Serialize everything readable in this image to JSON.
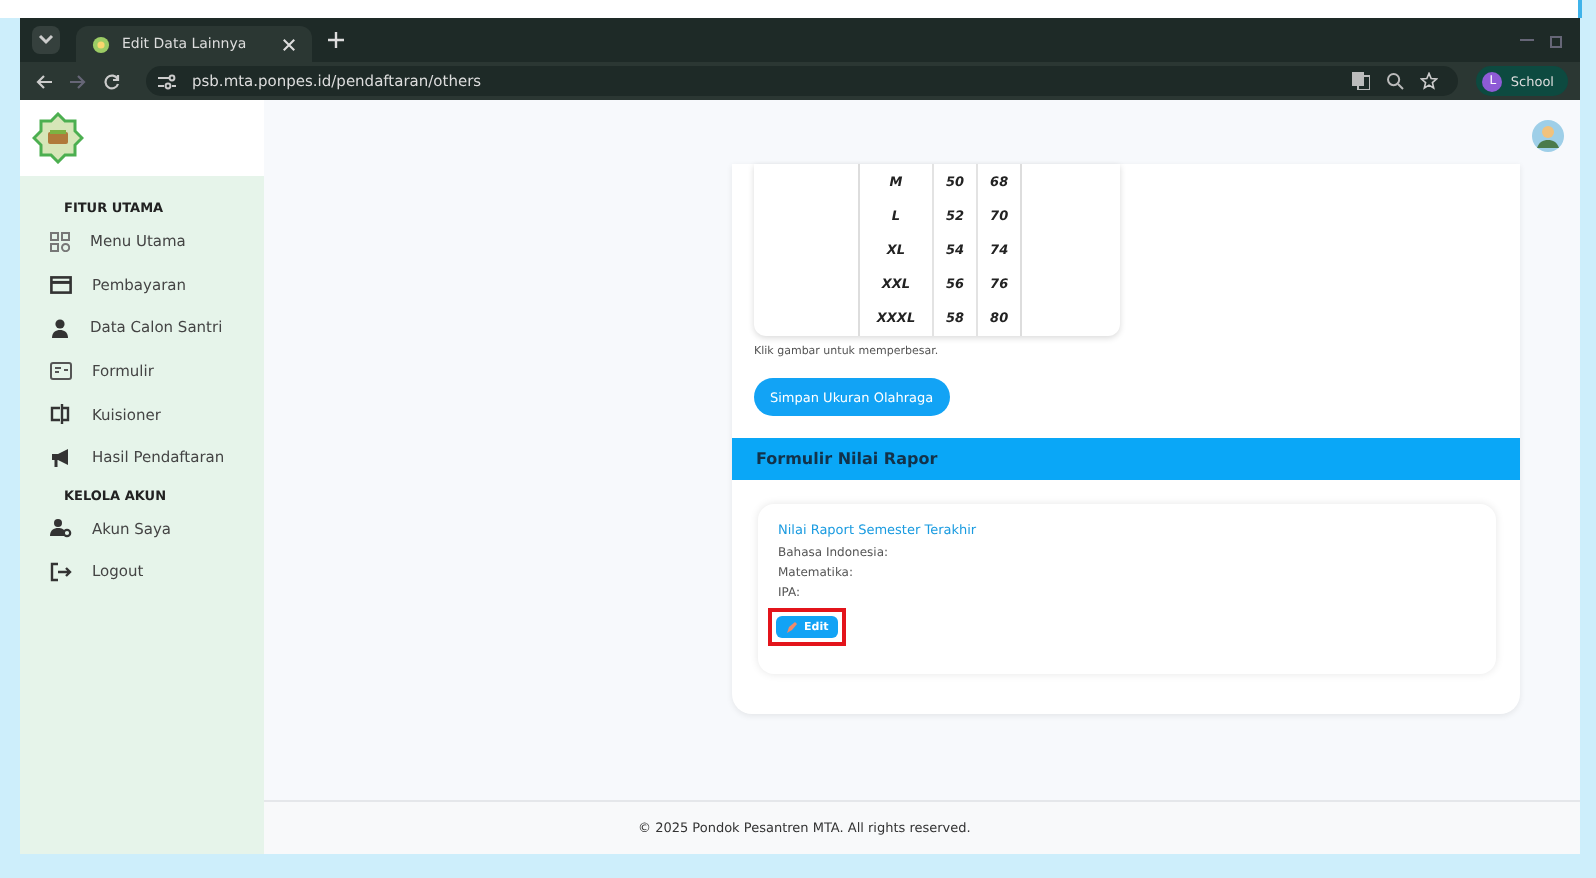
{
  "browser": {
    "tab_title": "Edit Data Lainnya",
    "url": "psb.mta.ponpes.id/pendaftaran/others",
    "profile_initial": "L",
    "profile_name": "School"
  },
  "sidebar": {
    "sections": [
      {
        "heading": "FITUR UTAMA",
        "items": [
          {
            "label": "Menu Utama",
            "kind": "grid"
          },
          {
            "label": "Pembayaran",
            "kind": "card"
          },
          {
            "label": "Data Calon Santri",
            "kind": "person"
          },
          {
            "label": "Formulir",
            "kind": "form"
          },
          {
            "label": "Kuisioner",
            "kind": "quiz"
          },
          {
            "label": "Hasil Pendaftaran",
            "kind": "megaphone"
          }
        ]
      },
      {
        "heading": "KELOLA AKUN",
        "items": [
          {
            "label": "Akun Saya",
            "kind": "account"
          },
          {
            "label": "Logout",
            "kind": "logout"
          }
        ]
      }
    ]
  },
  "size_table": {
    "rows": [
      [
        "M",
        "50",
        "68"
      ],
      [
        "L",
        "52",
        "70"
      ],
      [
        "XL",
        "54",
        "74"
      ],
      [
        "XXL",
        "56",
        "76"
      ],
      [
        "XXXL",
        "58",
        "80"
      ]
    ]
  },
  "size_hint": "Klik gambar untuk memperbesar.",
  "save_button": "Simpan Ukuran Olahraga",
  "rapor": {
    "header": "Formulir Nilai Rapor",
    "title": "Nilai Raport Semester Terakhir",
    "fields": [
      "Bahasa Indonesia:",
      "Matematika:",
      "IPA:"
    ],
    "edit_button": {
      "label": "Edit",
      "highlighted": true
    }
  },
  "footer": "© 2025 Pondok Pesantren MTA. All rights reserved."
}
